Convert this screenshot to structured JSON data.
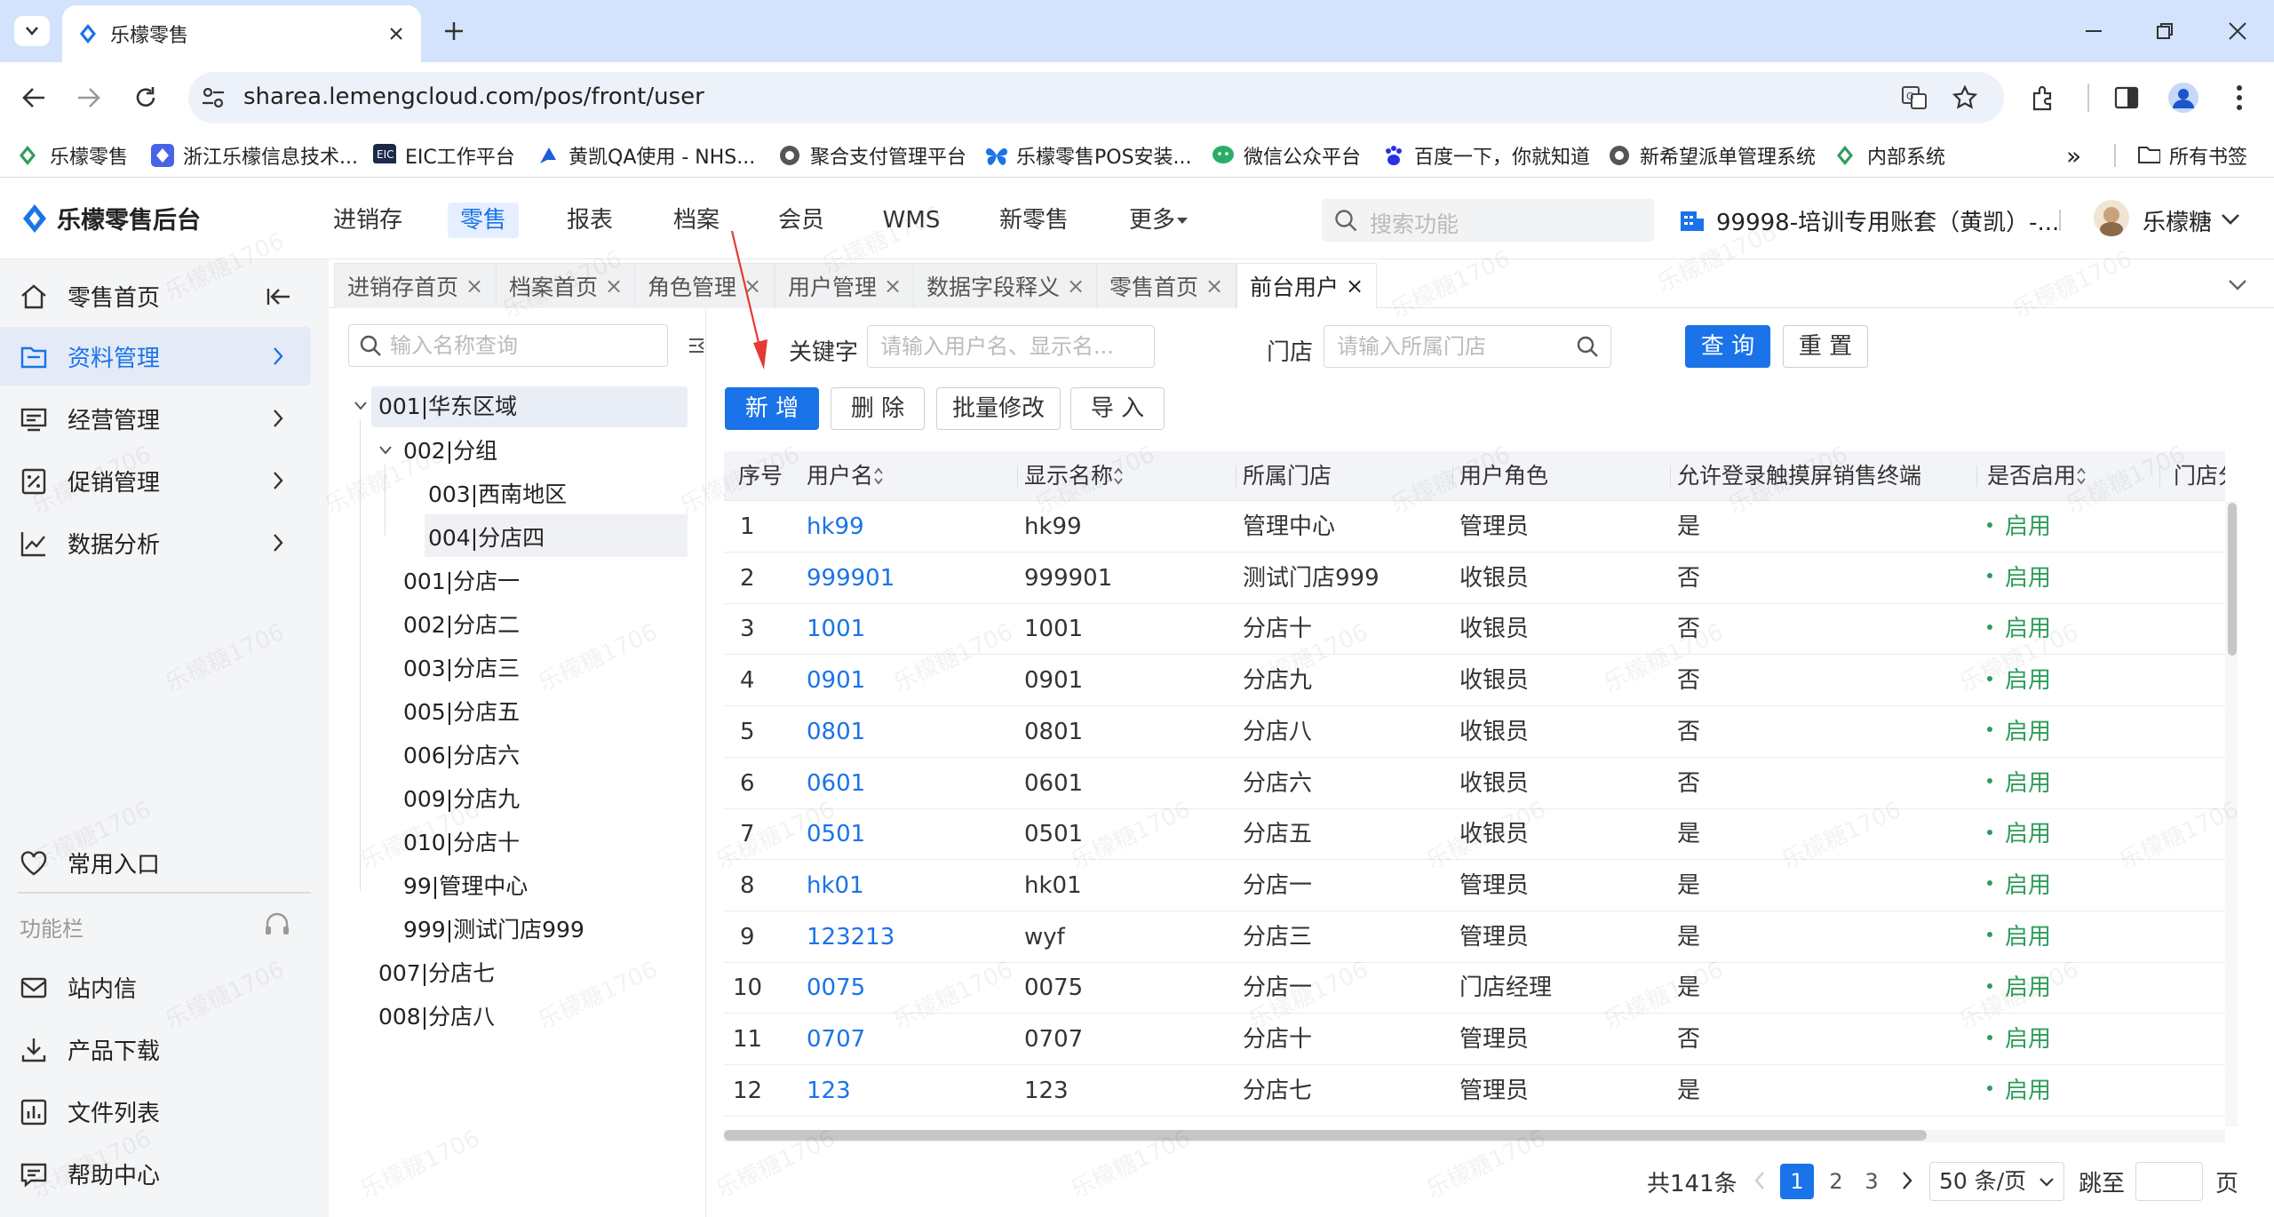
{
  "browser": {
    "tab_title": "乐檬零售",
    "url": "sharea.lemengcloud.com/pos/front/user",
    "bookmarks": [
      "乐檬零售",
      "浙江乐檬信息技术...",
      "EIC工作平台",
      "黄凯QA使用 - NHS...",
      "聚合支付管理平台",
      "乐檬零售POS安装...",
      "微信公众平台",
      "百度一下，你就知道",
      "新希望派单管理系统",
      "内部系统"
    ],
    "all_bookmarks": "所有书签",
    "more_bookmarks": "»"
  },
  "app": {
    "logo_text": "乐檬零售后台",
    "nav": [
      "进销存",
      "零售",
      "报表",
      "档案",
      "会员",
      "WMS",
      "新零售",
      "更多"
    ],
    "active_nav": "零售",
    "search_placeholder": "搜索功能",
    "account": "99998-培训专用账套（黄凯）-...",
    "user": "乐檬糖",
    "watermark": "乐檬糖1706"
  },
  "sidebar": {
    "items": [
      "零售首页",
      "资料管理",
      "经营管理",
      "促销管理",
      "数据分析"
    ],
    "collapse_icon": "collapse-left-icon",
    "common_entry": "常用入口",
    "func_bar": "功能栏",
    "bottom_items": [
      "站内信",
      "产品下载",
      "文件列表",
      "帮助中心"
    ]
  },
  "tabs": [
    "进销存首页",
    "档案首页",
    "角色管理",
    "用户管理",
    "数据字段释义",
    "零售首页",
    "前台用户"
  ],
  "tab_close": "×",
  "tree": {
    "search_placeholder": "输入名称查询",
    "nodes": [
      {
        "label": "001|华东区域",
        "level": 0,
        "expanded": true
      },
      {
        "label": "002|分组",
        "level": 1,
        "expanded": true
      },
      {
        "label": "003|西南地区",
        "level": 2
      },
      {
        "label": "004|分店四",
        "level": 2
      },
      {
        "label": "001|分店一",
        "level": 1
      },
      {
        "label": "002|分店二",
        "level": 1
      },
      {
        "label": "003|分店三",
        "level": 1
      },
      {
        "label": "005|分店五",
        "level": 1
      },
      {
        "label": "006|分店六",
        "level": 1
      },
      {
        "label": "009|分店九",
        "level": 1
      },
      {
        "label": "010|分店十",
        "level": 1
      },
      {
        "label": "99|管理中心",
        "level": 1
      },
      {
        "label": "999|测试门店999",
        "level": 1
      },
      {
        "label": "007|分店七",
        "level": 0
      },
      {
        "label": "008|分店八",
        "level": 0
      }
    ]
  },
  "filters": {
    "keyword_label": "关键字",
    "keyword_placeholder": "请输入用户名、显示名...",
    "store_label": "门店",
    "store_placeholder": "请输入所属门店",
    "query": "查 询",
    "reset": "重 置"
  },
  "actions": [
    "新 增",
    "删 除",
    "批量修改",
    "导 入"
  ],
  "table": {
    "columns": [
      "序号",
      "用户名",
      "显示名称",
      "所属门店",
      "用户角色",
      "允许登录触摸屏销售终端",
      "是否启用",
      "门店分"
    ],
    "rows": [
      [
        "1",
        "hk99",
        "hk99",
        "管理中心",
        "管理员",
        "是",
        "启用"
      ],
      [
        "2",
        "999901",
        "999901",
        "测试门店999",
        "收银员",
        "否",
        "启用"
      ],
      [
        "3",
        "1001",
        "1001",
        "分店十",
        "收银员",
        "否",
        "启用"
      ],
      [
        "4",
        "0901",
        "0901",
        "分店九",
        "收银员",
        "否",
        "启用"
      ],
      [
        "5",
        "0801",
        "0801",
        "分店八",
        "收银员",
        "否",
        "启用"
      ],
      [
        "6",
        "0601",
        "0601",
        "分店六",
        "收银员",
        "否",
        "启用"
      ],
      [
        "7",
        "0501",
        "0501",
        "分店五",
        "收银员",
        "是",
        "启用"
      ],
      [
        "8",
        "hk01",
        "hk01",
        "分店一",
        "管理员",
        "是",
        "启用"
      ],
      [
        "9",
        "123213",
        "wyf",
        "分店三",
        "管理员",
        "是",
        "启用"
      ],
      [
        "10",
        "0075",
        "0075",
        "分店一",
        "门店经理",
        "是",
        "启用"
      ],
      [
        "11",
        "0707",
        "0707",
        "分店十",
        "管理员",
        "否",
        "启用"
      ],
      [
        "12",
        "123",
        "123",
        "分店七",
        "管理员",
        "是",
        "启用"
      ]
    ]
  },
  "pagination": {
    "total": "共141条",
    "pages": [
      "1",
      "2",
      "3"
    ],
    "current": "1",
    "page_size": "50 条/页",
    "goto": "跳至",
    "page_unit": "页"
  },
  "colors": {
    "primary": "#1a73e8",
    "enabled": "#2e9d59",
    "annotation": "#e53935"
  }
}
